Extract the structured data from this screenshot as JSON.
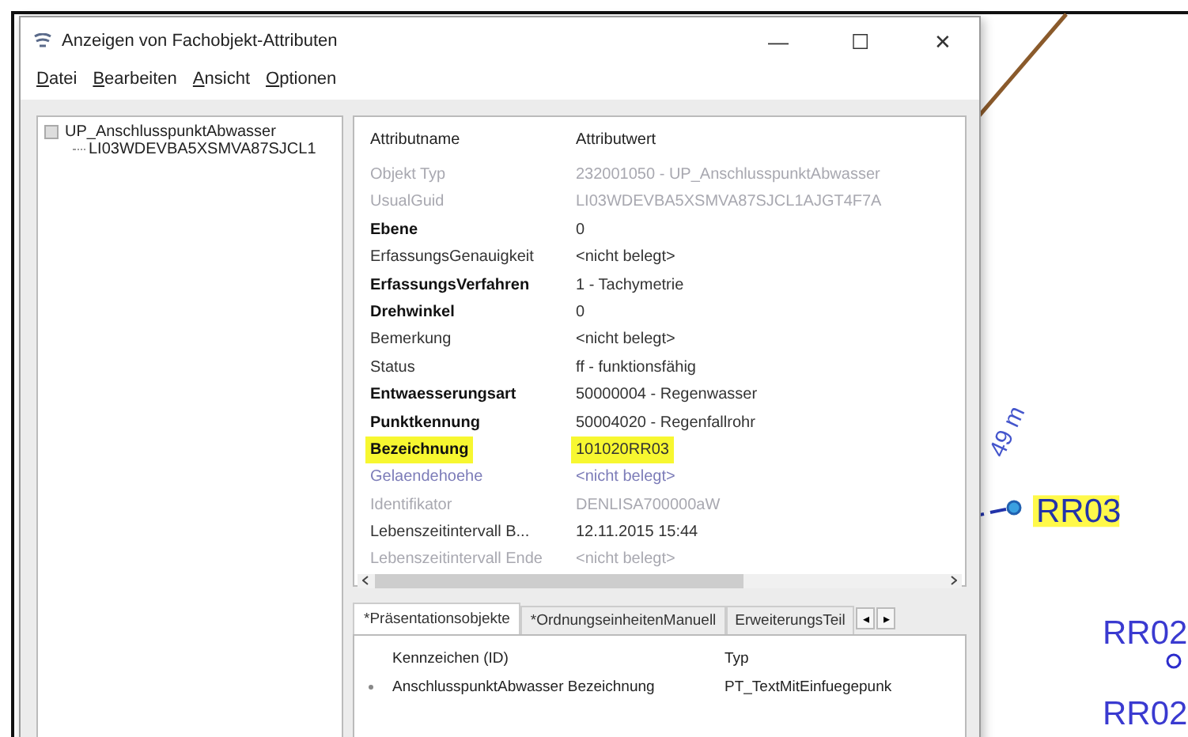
{
  "window": {
    "title": "Anzeigen von Fachobjekt-Attributen",
    "controls": [
      "—",
      "☐",
      "✕"
    ]
  },
  "menu": [
    {
      "label": "Datei"
    },
    {
      "label": "Bearbeiten"
    },
    {
      "label": "Ansicht"
    },
    {
      "label": "Optionen"
    }
  ],
  "tree": {
    "label": "UP_AnschlusspunktAbwasser",
    "expanded": true,
    "children": [
      {
        "label": "LI03WDEVBA5XSMVA87SJCL1"
      }
    ]
  },
  "attributes": {
    "columns": [
      "Attributname",
      "Attributwert"
    ],
    "rows": [
      {
        "name": "Objekt Typ",
        "value": "232001050 - UP_AnschlusspunktAbwasser",
        "kind": "disabled",
        "highlighted": false
      },
      {
        "name": "UsualGuid",
        "value": "LI03WDEVBA5XSMVA87SJCL1AJGT4F7A",
        "kind": "disabled",
        "highlighted": false
      },
      {
        "name": "Ebene",
        "value": "0",
        "kind": "bold",
        "highlighted": false
      },
      {
        "name": "ErfassungsGenauigkeit",
        "value": "<nicht belegt>",
        "kind": "normal",
        "highlighted": false
      },
      {
        "name": "ErfassungsVerfahren",
        "value": "1 - Tachymetrie",
        "kind": "bold",
        "highlighted": false
      },
      {
        "name": "Drehwinkel",
        "value": "0",
        "kind": "bold",
        "highlighted": false
      },
      {
        "name": "Bemerkung",
        "value": "<nicht belegt>",
        "kind": "normal",
        "highlighted": false
      },
      {
        "name": "Status",
        "value": "ff - funktionsfähig",
        "kind": "normal",
        "highlighted": false
      },
      {
        "name": "Entwaesserungsart",
        "value": "50000004 - Regenwasser",
        "kind": "bold",
        "highlighted": false
      },
      {
        "name": "Punktkennung",
        "value": "50004020 - Regenfallrohr",
        "kind": "bold",
        "highlighted": false
      },
      {
        "name": "Bezeichnung",
        "value": "101020RR03",
        "kind": "bold",
        "highlighted": true
      },
      {
        "name": "Gelaendehoehe",
        "value": "<nicht belegt>",
        "kind": "derived",
        "highlighted": false
      },
      {
        "name": "Identifikator",
        "value": "DENLISA700000aW",
        "kind": "disabled",
        "highlighted": false
      },
      {
        "name": "Lebenszeitintervall B...",
        "value": "12.11.2015 15:44",
        "kind": "normal",
        "highlighted": false
      },
      {
        "name": "Lebenszeitintervall Ende",
        "value": "<nicht belegt>",
        "kind": "disabled",
        "highlighted": false
      }
    ]
  },
  "tabs": [
    {
      "label": "*Präsentationsobjekte",
      "selected": true
    },
    {
      "label": "*OrdnungseinheitenManuell",
      "selected": false
    },
    {
      "label": "ErweiterungsTeil",
      "selected": false
    }
  ],
  "tab_scroll": [
    "◂",
    "▸"
  ],
  "objects": {
    "columns": [
      "Kennzeichen (ID)",
      "Typ"
    ],
    "rows": [
      [
        "AnschlusspunktAbwasser Bezeichnung",
        "PT_TextMitEinfuegepunk"
      ]
    ]
  },
  "map": {
    "labels": [
      {
        "text": "49 m",
        "kind": "distance",
        "highlighted": false
      },
      {
        "text": "RR03",
        "kind": "point",
        "highlighted": true
      },
      {
        "text": "RR02",
        "kind": "point",
        "highlighted": false
      },
      {
        "text": "RR02",
        "kind": "point",
        "highlighted": false
      }
    ]
  }
}
